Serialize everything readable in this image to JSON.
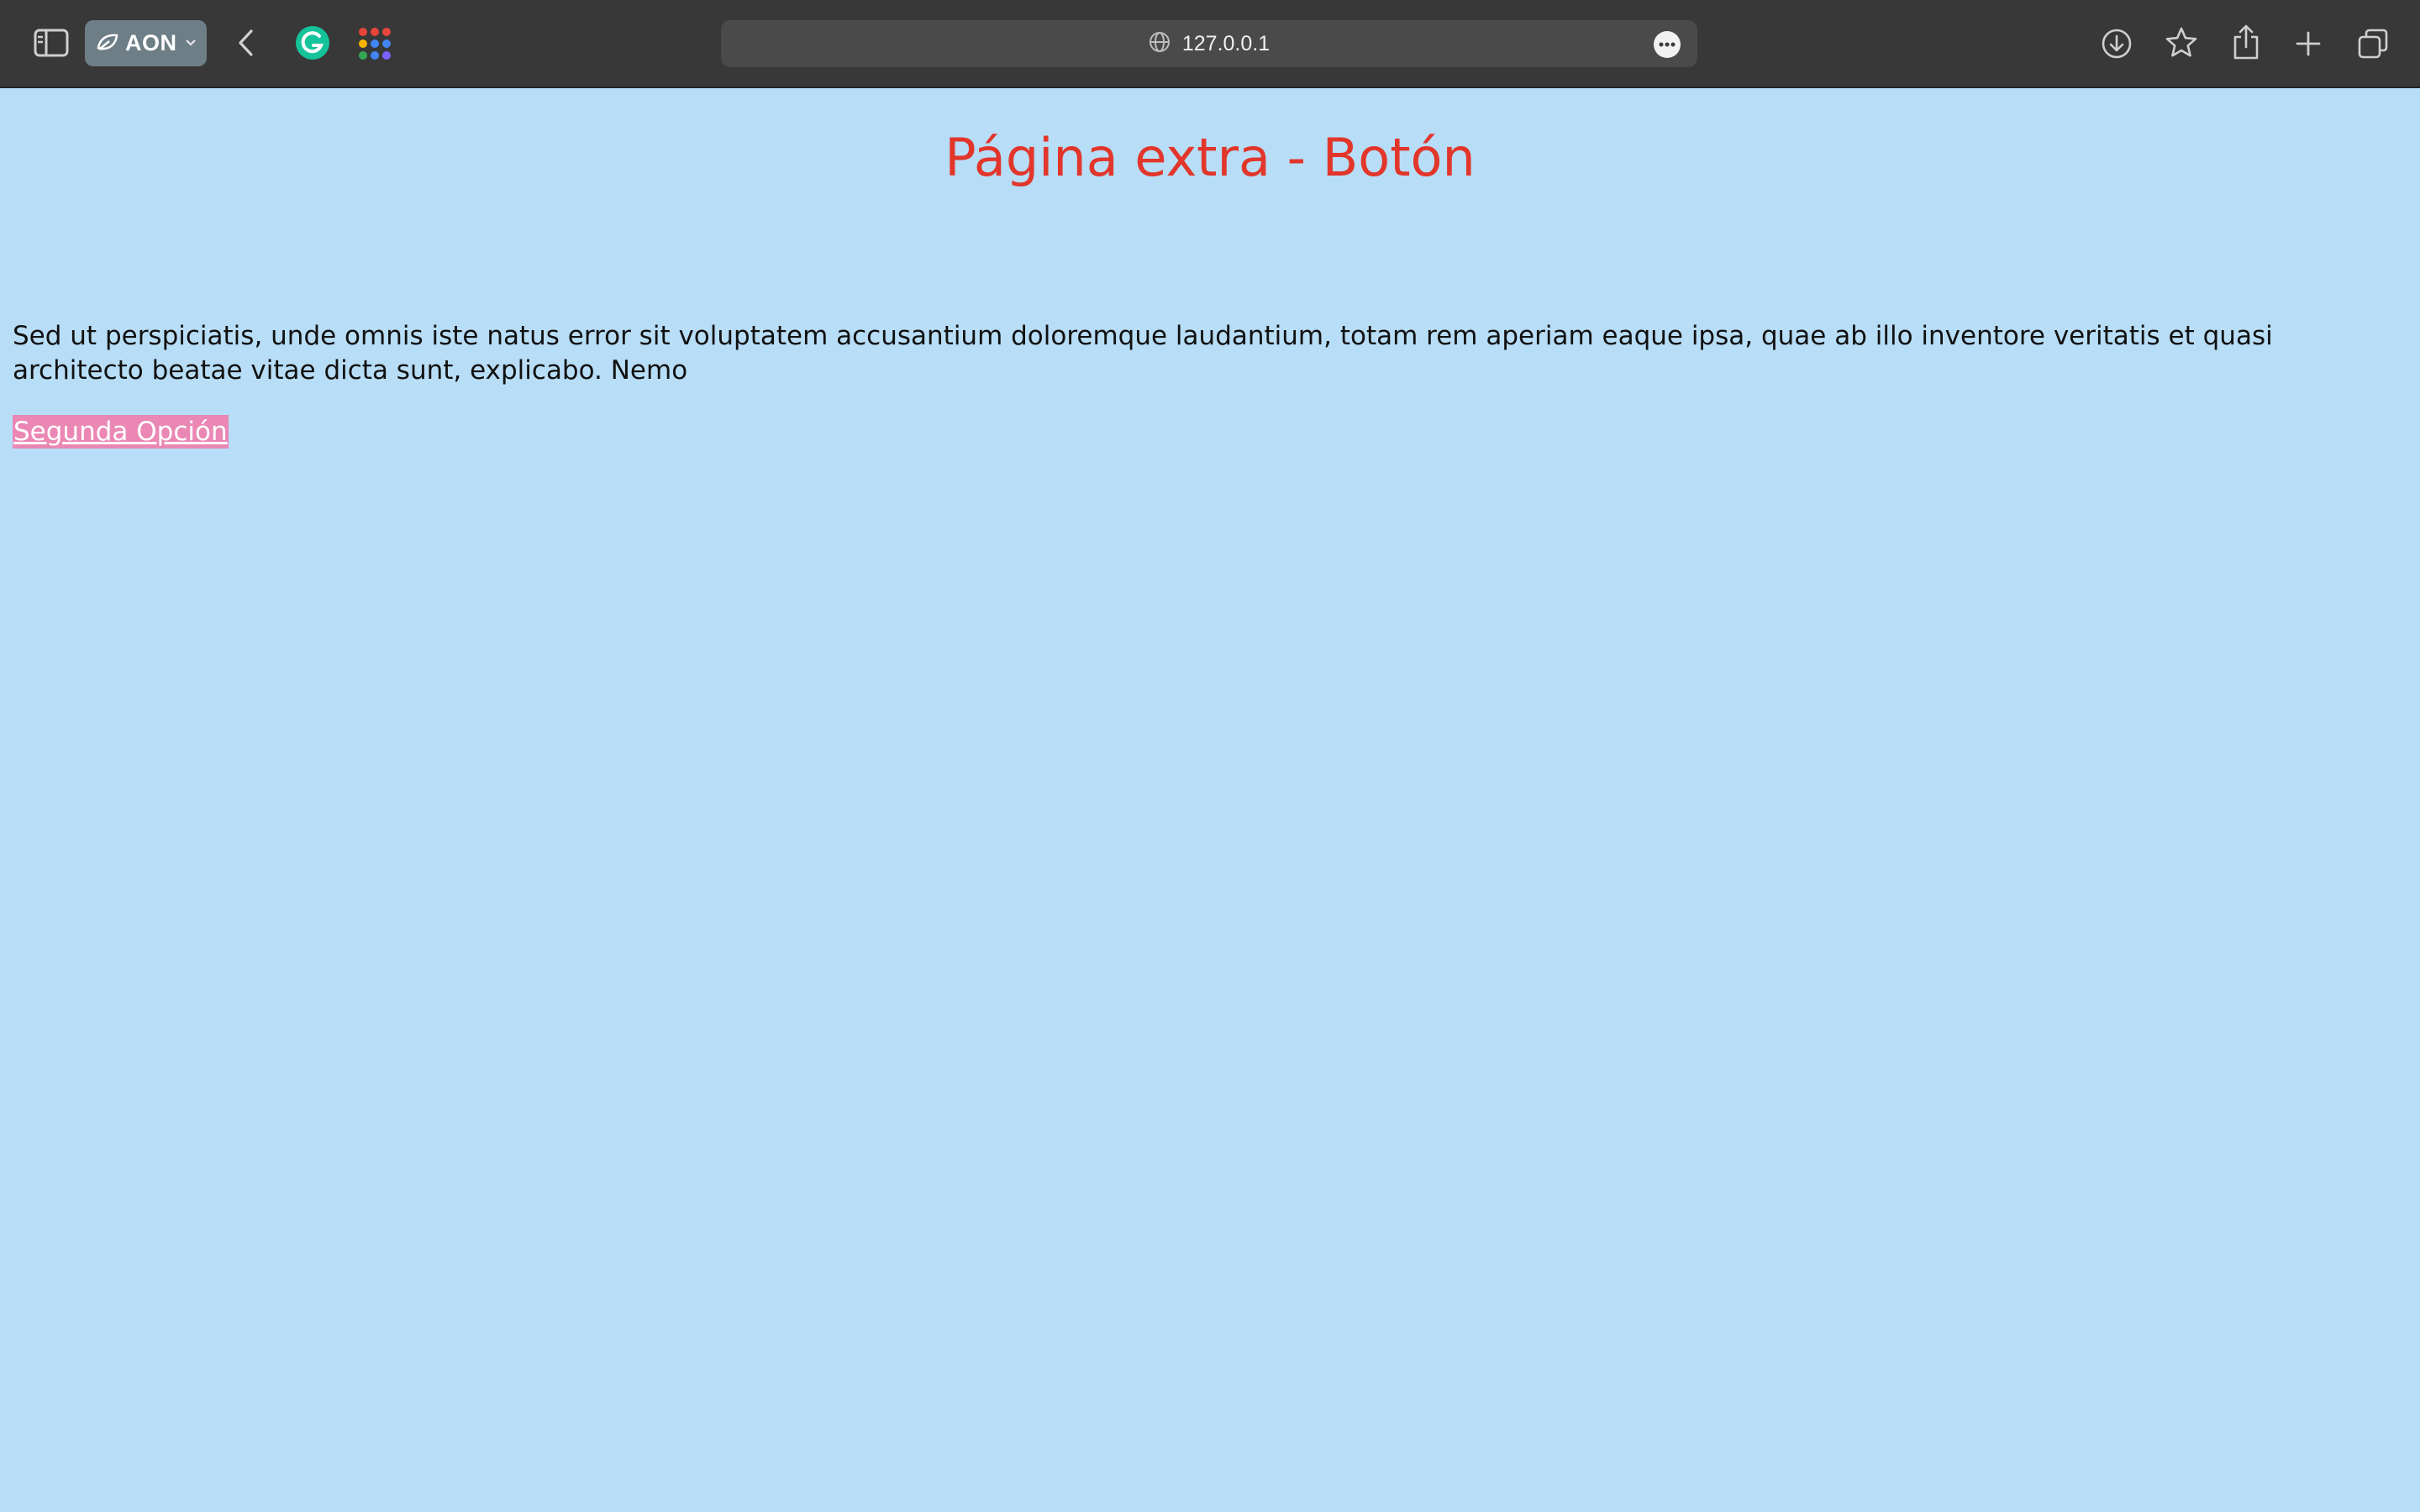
{
  "browser": {
    "profile_name": "AON",
    "url": "127.0.0.1",
    "icons": {
      "sidebar": "sidebar-toggle-icon",
      "profile": "leaf-icon",
      "back": "chevron-left-icon",
      "grammarly": "grammarly-icon",
      "apps": "apps-grid-icon",
      "site": "globe-icon",
      "more": "ellipsis-icon",
      "download": "download-icon",
      "bookmark": "star-icon",
      "share": "share-icon",
      "new_tab": "plus-icon",
      "tab_overview": "tabs-icon"
    },
    "colors": {
      "toolbar": "#383838",
      "profile_pill": "#6e7e87",
      "grammarly": "#15c39a"
    }
  },
  "page": {
    "title": "Página extra - Botón",
    "paragraph": "Sed ut perspiciatis, unde omnis iste natus error sit voluptatem accusantium doloremque laudantium, totam rem aperiam eaque ipsa, quae ab illo inventore veritatis et quasi architecto beatae vitae dicta sunt, explicabo. Nemo",
    "link_label": "Segunda Opción",
    "colors": {
      "background": "#b8ddf6",
      "title": "#e2362b",
      "link_background": "#ea87b4",
      "link_text": "#ffffff"
    }
  }
}
